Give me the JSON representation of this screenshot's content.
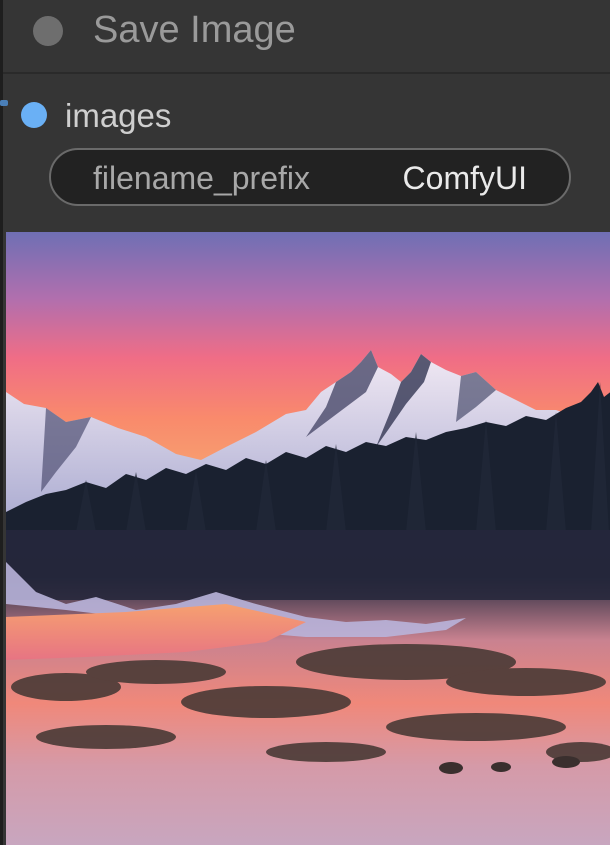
{
  "node": {
    "title": "Save Image",
    "input_label": "images",
    "widget": {
      "name": "filename_prefix",
      "value": "ComfyUI"
    },
    "preview_image_name": "mountain-lake-sunset-image"
  },
  "colors": {
    "node_bg": "#353535",
    "title_text": "#9a9a9a",
    "input_slot": "#6ab0f5",
    "widget_bg": "#222222",
    "widget_border": "#6a6a6a"
  },
  "icons": {
    "title_dot": "node-collapse-dot-icon",
    "input_slot": "input-connection-dot-icon"
  }
}
